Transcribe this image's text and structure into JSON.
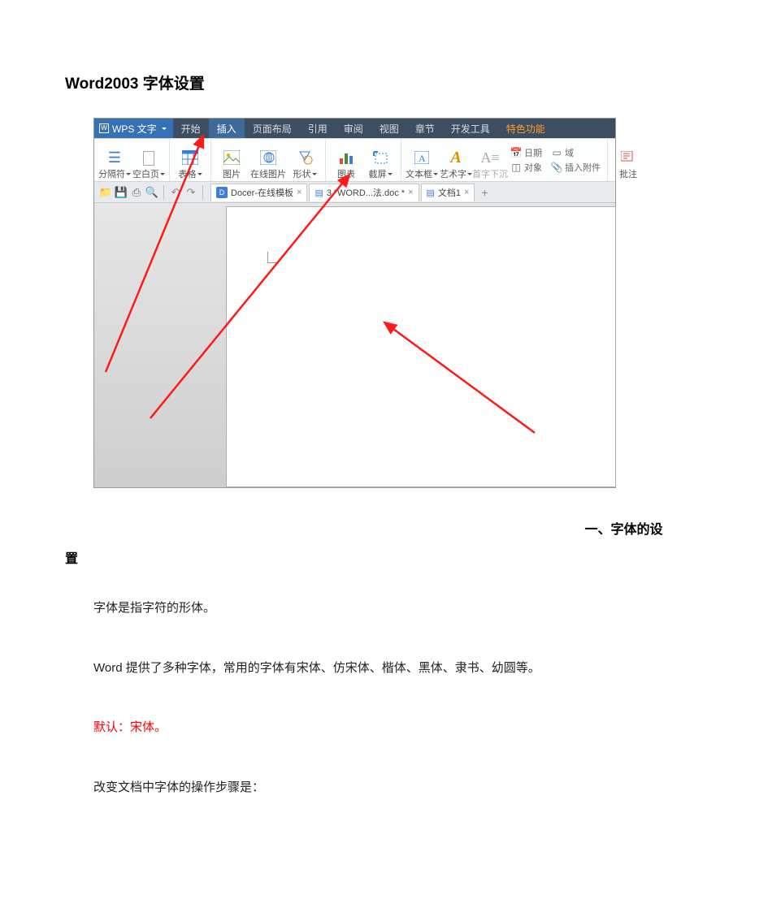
{
  "doc_title": "Word2003 字体设置",
  "wps": {
    "app_label": "WPS 文字",
    "menus": [
      "开始",
      "插入",
      "页面布局",
      "引用",
      "审阅",
      "视图",
      "章节",
      "开发工具",
      "特色功能"
    ],
    "active_menu_index": 1,
    "ribbon": {
      "separator": "分隔符",
      "blank_page": "空白页",
      "table": "表格",
      "picture": "图片",
      "online_picture": "在线图片",
      "shapes": "形状",
      "chart": "图表",
      "screenshot": "截屏",
      "textbox": "文本框",
      "art": "艺术字",
      "dropcap": "首字下沉",
      "object": "对象",
      "date": "日期",
      "field": "域",
      "attachment": "插入附件",
      "comment": "批注"
    },
    "tabs": [
      "Docer-在线模板",
      "3 \"WORD...法.doc *",
      "文档1"
    ]
  },
  "section_heading_prefix": "一、",
  "section_heading": "字体的设置",
  "para1": "字体是指字符的形体。",
  "para2": "Word 提供了多种字体，常用的字体有宋体、仿宋体、楷体、黑体、隶书、幼圆等。",
  "para3": "默认：宋体。",
  "para4": "改变文档中字体的操作步骤是："
}
